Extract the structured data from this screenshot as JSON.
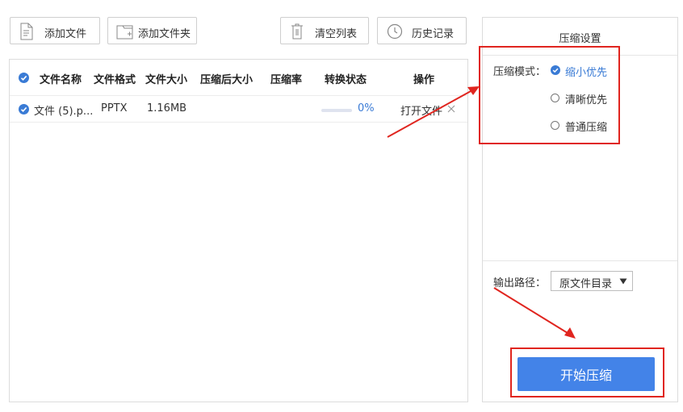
{
  "toolbar": {
    "add_file": "添加文件",
    "add_folder": "添加文件夹",
    "clear_list": "清空列表",
    "history": "历史记录"
  },
  "table": {
    "columns": [
      "文件名称",
      "文件格式",
      "文件大小",
      "压缩后大小",
      "压缩率",
      "转换状态",
      "操作"
    ],
    "rows": [
      {
        "name": "文件 (5).p...",
        "format": "PPTX",
        "size": "1.16MB",
        "compressed_size": "",
        "ratio": "",
        "progress_percent": 0,
        "progress_text": "0%",
        "action_label": "打开文件"
      }
    ]
  },
  "settings": {
    "title": "压缩设置",
    "mode_label": "压缩模式：",
    "modes": [
      {
        "label": "缩小优先",
        "selected": true
      },
      {
        "label": "清晰优先",
        "selected": false
      },
      {
        "label": "普通压缩",
        "selected": false
      }
    ],
    "output_label": "输出路径：",
    "output_value": "原文件目录",
    "start_label": "开始压缩"
  },
  "colors": {
    "accent": "#3a7bd5",
    "start_button": "#4383e8",
    "highlight_red": "#e0251f"
  }
}
